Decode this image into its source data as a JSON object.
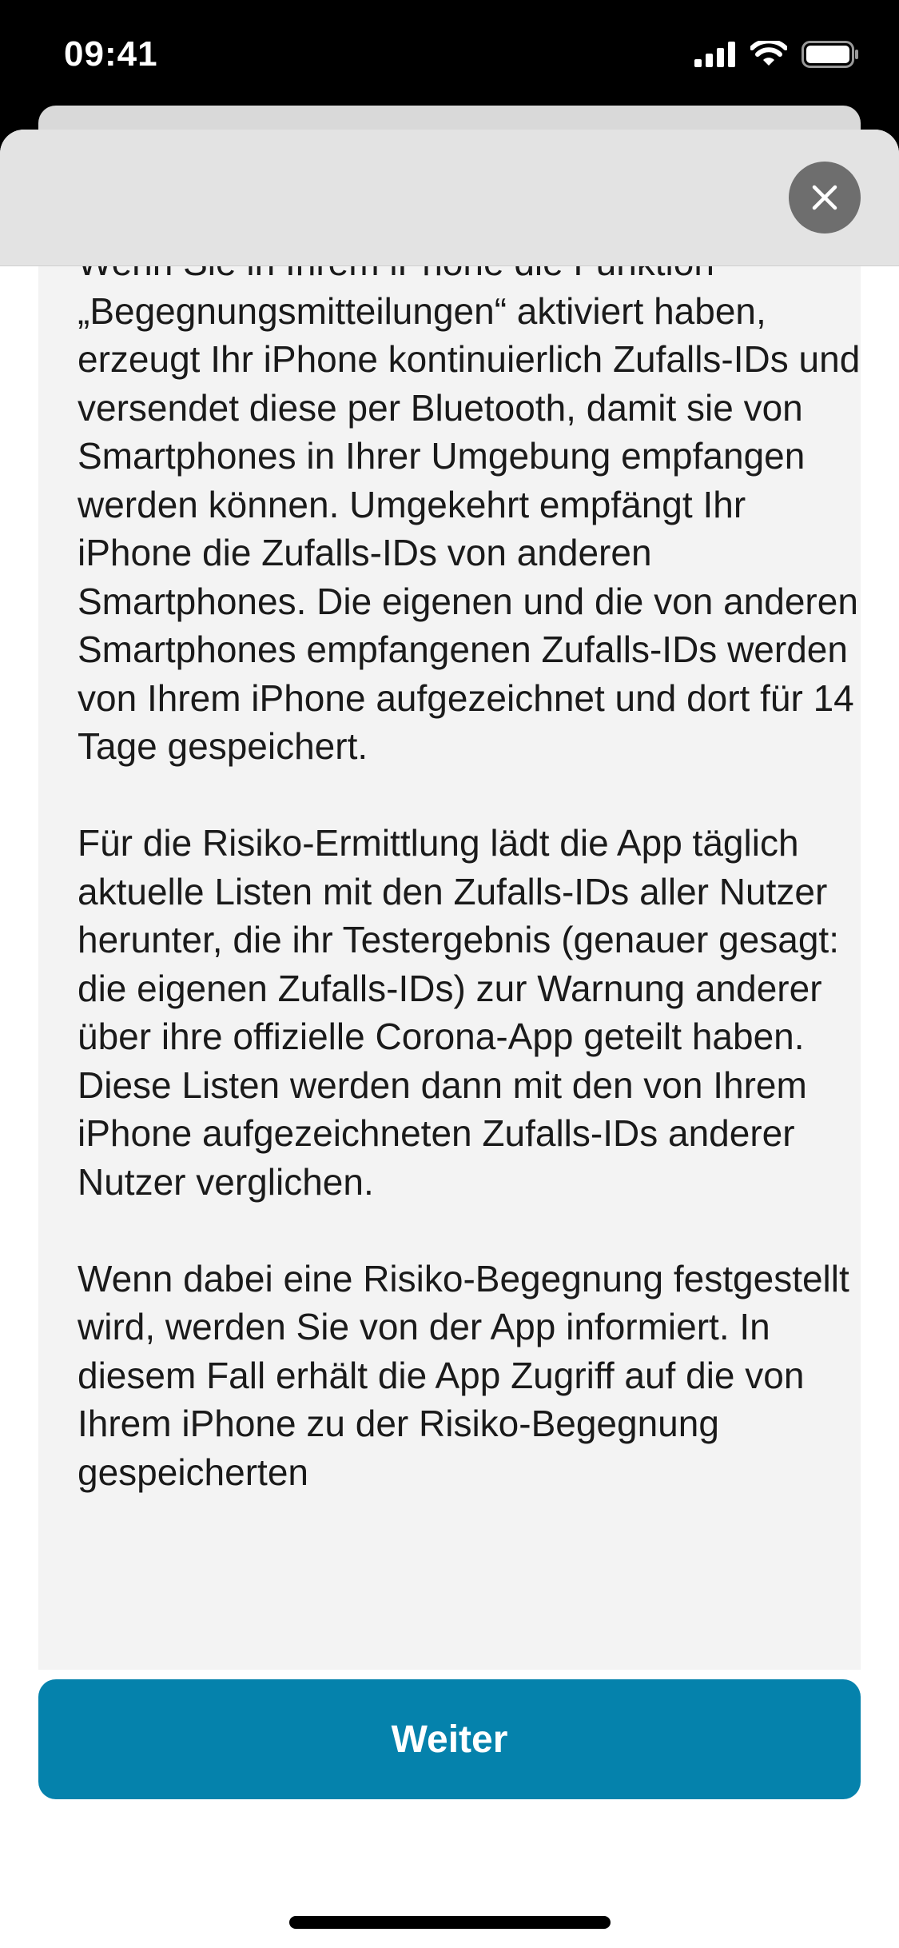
{
  "status_bar": {
    "time": "09:41"
  },
  "close_button": {
    "icon": "close-icon"
  },
  "body_paragraphs": [
    "Wenn Sie in Ihrem iPhone die Funktion „Begegnungsmitteilungen“ aktiviert haben, erzeugt Ihr iPhone kontinuierlich Zufalls-IDs und versendet diese per Bluetooth, damit sie von Smartphones in Ihrer Umgebung empfangen werden können. Umgekehrt empfängt Ihr iPhone die Zufalls-IDs von anderen Smartphones. Die eigenen und die von anderen Smartphones empfangenen Zufalls-IDs werden von Ihrem iPhone aufgezeichnet und dort für 14 Tage gespeichert.",
    "Für die Risiko-Ermittlung lädt die App täglich aktuelle Listen mit den Zufalls-IDs aller Nutzer herunter, die ihr Testergebnis (genauer gesagt: die eigenen Zufalls-IDs) zur Warnung anderer über ihre offizielle Corona-App geteilt haben. Diese Listen werden dann mit den von Ihrem iPhone aufgezeichneten Zufalls-IDs anderer Nutzer verglichen.",
    "Wenn dabei eine Risiko-Begegnung festgestellt wird, werden Sie von der App informiert. In diesem Fall erhält die App Zugriff auf die von Ihrem iPhone zu der Risiko-Begegnung gespeicherten"
  ],
  "footer": {
    "continue_label": "Weiter"
  },
  "colors": {
    "accent": "#0582ac",
    "panel_background": "#f3f3f3",
    "text": "#1a1a1a"
  }
}
